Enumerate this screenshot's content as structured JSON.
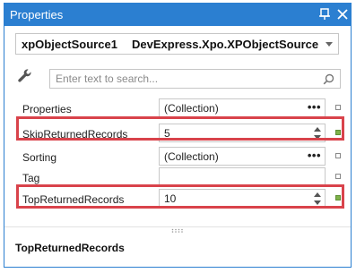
{
  "window": {
    "title": "Properties"
  },
  "object_selector": {
    "name": "xpObjectSource1",
    "type": "DevExpress.Xpo.XPObjectSource"
  },
  "search": {
    "placeholder": "Enter text to search..."
  },
  "properties": [
    {
      "label": "Properties",
      "value": "(Collection)",
      "editor": "ellipsis",
      "modified": false,
      "highlighted": false
    },
    {
      "label": "SkipReturnedRecords",
      "value": "5",
      "editor": "spin",
      "modified": true,
      "highlighted": true
    },
    {
      "label": "Sorting",
      "value": "(Collection)",
      "editor": "ellipsis",
      "modified": false,
      "highlighted": false
    },
    {
      "label": "Tag",
      "value": "",
      "editor": "text",
      "modified": false,
      "highlighted": false
    },
    {
      "label": "TopReturnedRecords",
      "value": "10",
      "editor": "spin",
      "modified": true,
      "highlighted": true
    }
  ],
  "ellipsis_glyph": "•••",
  "description": {
    "title": "TopReturnedRecords"
  },
  "colors": {
    "title_bar": "#2b7fd1",
    "highlight": "#d9434b",
    "modified_marker": "#7fb24a"
  }
}
